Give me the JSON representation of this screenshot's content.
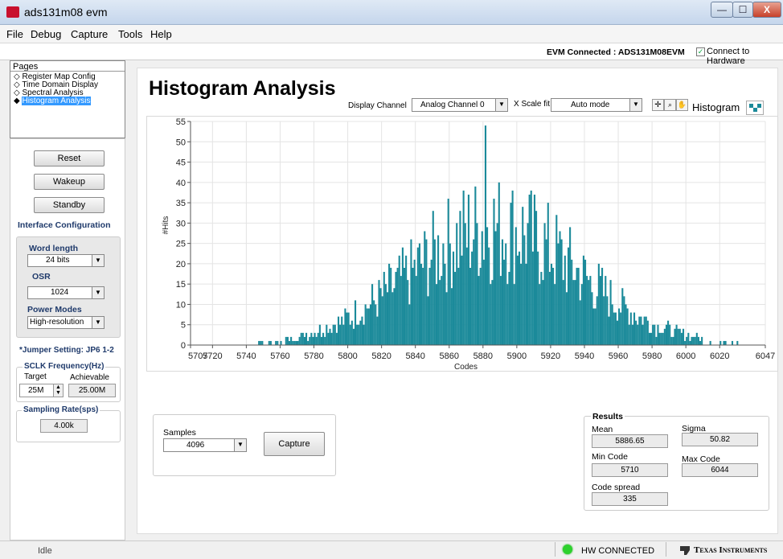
{
  "window": {
    "title": "ads131m08 evm",
    "minimize": "—",
    "maximize": "☐",
    "close": "X"
  },
  "menu": [
    "File",
    "Debug",
    "Capture",
    "Tools",
    "Help"
  ],
  "connection": {
    "status": "EVM Connected : ADS131M08EVM",
    "checkbox_label": "Connect to Hardware",
    "checked": true
  },
  "pages": {
    "title": "Pages",
    "items": [
      {
        "label": "Register Map Config",
        "selected": false
      },
      {
        "label": "Time Domain Display",
        "selected": false
      },
      {
        "label": "Spectral Analysis",
        "selected": false
      },
      {
        "label": "Histogram Analysis",
        "selected": true
      }
    ]
  },
  "controls": {
    "reset": "Reset",
    "wakeup": "Wakeup",
    "standby": "Standby"
  },
  "interface": {
    "title": "Interface Configuration",
    "word_length_label": "Word length",
    "word_length": "24 bits",
    "osr_label": "OSR",
    "osr": "1024",
    "power_label": "Power Modes",
    "power": "High-resolution"
  },
  "jumper": "*Jumper Setting: JP6 1-2",
  "sclk": {
    "title": "SCLK Frequency(Hz)",
    "target_label": "Target",
    "achievable_label": "Achievable",
    "target": "25M",
    "achievable": "25.00M"
  },
  "sampling": {
    "title": "Sampling Rate(sps)",
    "value": "4.00k"
  },
  "main": {
    "title": "Histogram Analysis",
    "display_channel_label": "Display Channel",
    "display_channel": "Analog Channel 0",
    "xscale_label": "X Scale fit",
    "xscale": "Auto mode",
    "histogram_label": "Histogram"
  },
  "chart_data": {
    "type": "bar",
    "title": "",
    "xlabel": "Codes",
    "ylabel": "#Hits",
    "xlim": [
      5707,
      6047
    ],
    "ylim": [
      0,
      55
    ],
    "x_ticks": [
      "5707",
      "5720",
      "5740",
      "5760",
      "5780",
      "5800",
      "5820",
      "5840",
      "5860",
      "5880",
      "5900",
      "5920",
      "5940",
      "5960",
      "5980",
      "6000",
      "6020",
      "6047"
    ],
    "y_ticks": [
      "0",
      "5",
      "10",
      "15",
      "20",
      "25",
      "30",
      "35",
      "40",
      "45",
      "50",
      "55"
    ],
    "color": "#1b8a9a",
    "grid": true,
    "distribution": {
      "mean": 5886.65,
      "sigma": 50.82,
      "min": 5710,
      "max": 6044,
      "peak": 54
    }
  },
  "capture": {
    "samples_label": "Samples",
    "samples": "4096",
    "button": "Capture"
  },
  "results": {
    "title": "Results",
    "mean_label": "Mean",
    "mean": "5886.65",
    "sigma_label": "Sigma",
    "sigma": "50.82",
    "min_label": "Min Code",
    "min": "5710",
    "max_label": "Max Code",
    "max": "6044",
    "spread_label": "Code spread",
    "spread": "335"
  },
  "statusbar": {
    "state": "Idle",
    "hw": "HW CONNECTED",
    "brand": "Texas Instruments"
  }
}
